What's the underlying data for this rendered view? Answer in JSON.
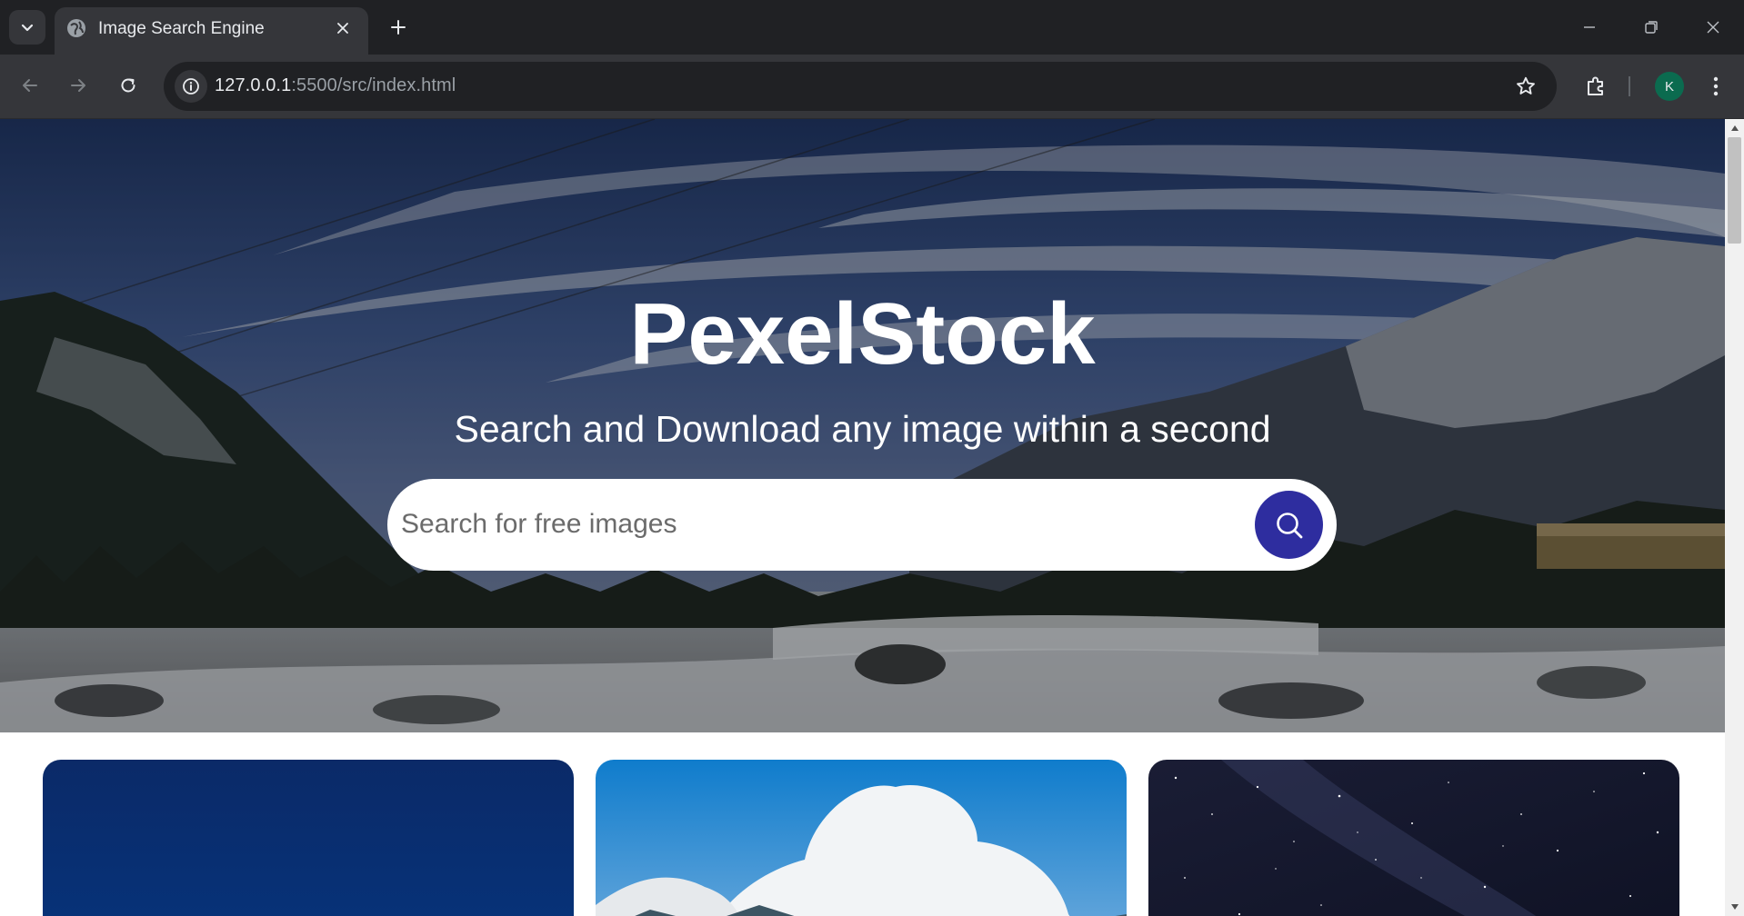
{
  "browser": {
    "tab_title": "Image Search Engine",
    "url_host": "127.0.0.1",
    "url_path": ":5500/src/index.html",
    "profile_initial": "K",
    "icons": {
      "tab_list": "chevron-down-icon",
      "favicon": "globe-icon",
      "tab_close": "close-icon",
      "new_tab": "plus-icon",
      "minimize": "minimize-icon",
      "restore": "restore-icon",
      "close_window": "close-icon",
      "back": "arrow-left-icon",
      "forward": "arrow-right-icon",
      "reload": "reload-icon",
      "site_info": "info-icon",
      "bookmark": "star-icon",
      "extensions": "puzzle-icon",
      "menu": "kebab-menu-icon"
    }
  },
  "hero": {
    "title": "PexelStock",
    "subtitle": "Search and Download any image within a second",
    "search_placeholder": "Search for free images",
    "search_icon": "search-icon",
    "accent_color": "#2e2d9f"
  },
  "gallery": {
    "images": [
      {
        "subject": "deep blue sky"
      },
      {
        "subject": "clouds over mountains"
      },
      {
        "subject": "starry night sky"
      }
    ]
  }
}
